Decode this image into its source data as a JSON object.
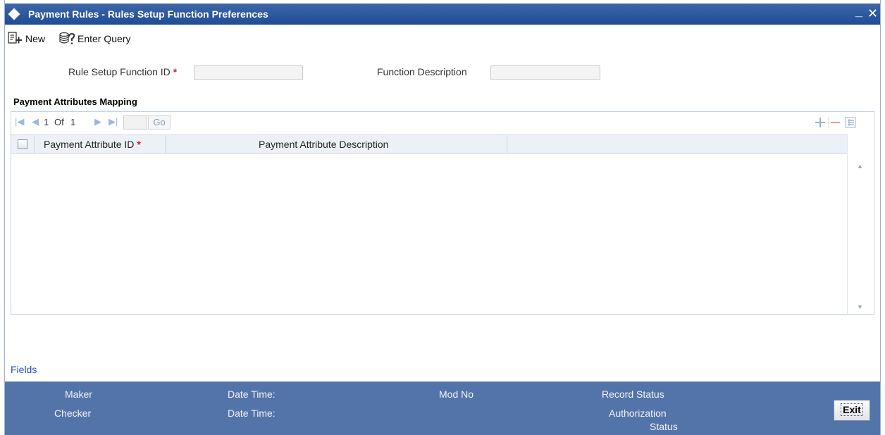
{
  "window": {
    "title": "Payment Rules - Rules Setup Function Preferences",
    "minimize_glyph": "_",
    "close_glyph": "✕"
  },
  "toolbar": {
    "new_label": "New",
    "enter_query_label": "Enter Query"
  },
  "form": {
    "rule_setup_function_id_label": "Rule Setup Function ID",
    "rule_setup_function_id_value": "",
    "function_description_label": "Function Description",
    "function_description_value": "",
    "required_marker": "*"
  },
  "grid": {
    "section_title": "Payment Attributes Mapping",
    "pager": {
      "current_page": "1",
      "of_label": "Of",
      "total_pages": "1",
      "page_input": "",
      "go_label": "Go"
    },
    "columns": [
      {
        "label": "Payment Attribute ID",
        "required": "*"
      },
      {
        "label": "Payment Attribute Description"
      }
    ],
    "rows": []
  },
  "footer": {
    "fields_link": "Fields",
    "maker_label": "Maker",
    "checker_label": "Checker",
    "date_time_label_1": "Date Time:",
    "date_time_label_2": "Date Time:",
    "mod_no_label": "Mod No",
    "record_status_label": "Record Status",
    "authorization_label": "Authorization",
    "status_label": "Status",
    "exit_label": "Exit"
  },
  "colors": {
    "titlebar": "#1e4c95",
    "footer": "#5374a9",
    "required": "#d81e1e",
    "link": "#2848c8"
  }
}
